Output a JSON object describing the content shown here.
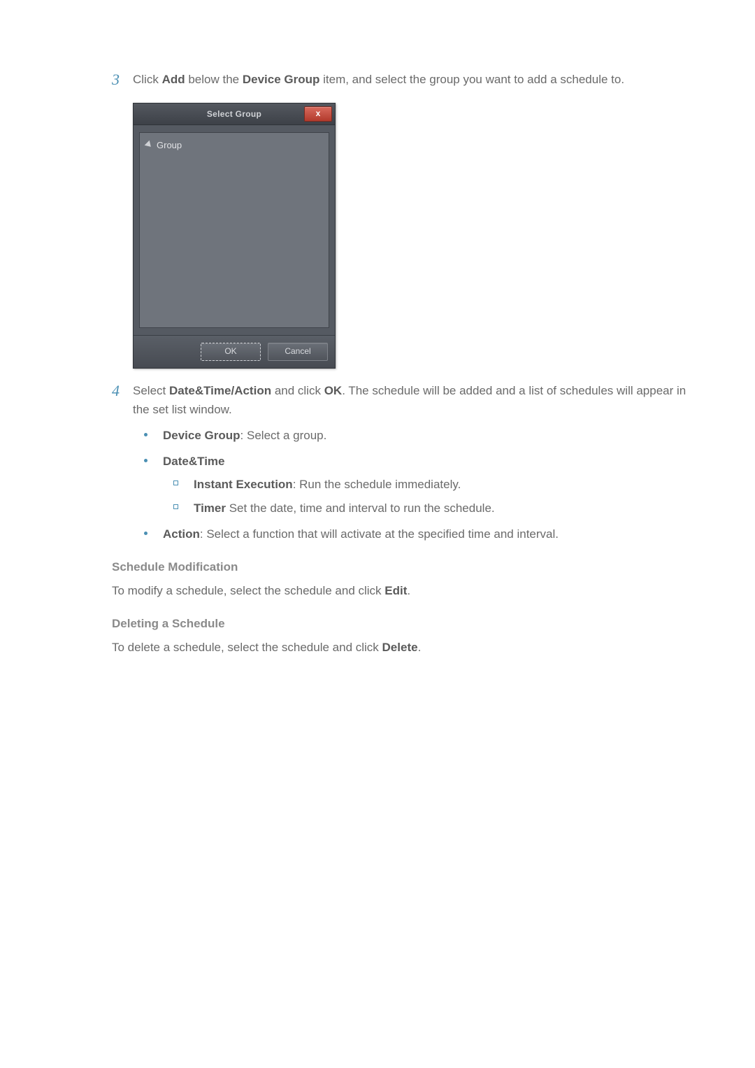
{
  "step3": {
    "num": "3",
    "pre": "Click ",
    "b1": "Add",
    "mid": " below the ",
    "b2": "Device Group",
    "post": " item, and select the group you want to add a schedule to."
  },
  "dialog": {
    "title": "Select Group",
    "close": "x",
    "tree_item": "Group",
    "ok": "OK",
    "cancel": "Cancel"
  },
  "step4": {
    "num": "4",
    "pre": "Select ",
    "b1": "Date&Time/Action",
    "mid": " and click ",
    "b2": "OK",
    "post": ". The schedule will be added and a list of schedules will appear in the set list window."
  },
  "bullets": {
    "device_group_b": "Device Group",
    "device_group_t": ": Select a group.",
    "datetime_b": "Date&Time",
    "instant_b": "Instant Execution",
    "instant_t": ": Run the schedule immediately.",
    "timer_b": "Timer",
    "timer_t": " Set the date, time and interval to run the schedule.",
    "action_b": "Action",
    "action_t": ": Select a function that will activate at the specified time and interval."
  },
  "schedule_mod": {
    "h": "Schedule Modification",
    "p_pre": "To modify a schedule, select the schedule and click ",
    "p_b": "Edit",
    "p_post": "."
  },
  "deleting": {
    "h": "Deleting a Schedule",
    "p_pre": "To delete a schedule, select the schedule and click ",
    "p_b": "Delete",
    "p_post": "."
  }
}
